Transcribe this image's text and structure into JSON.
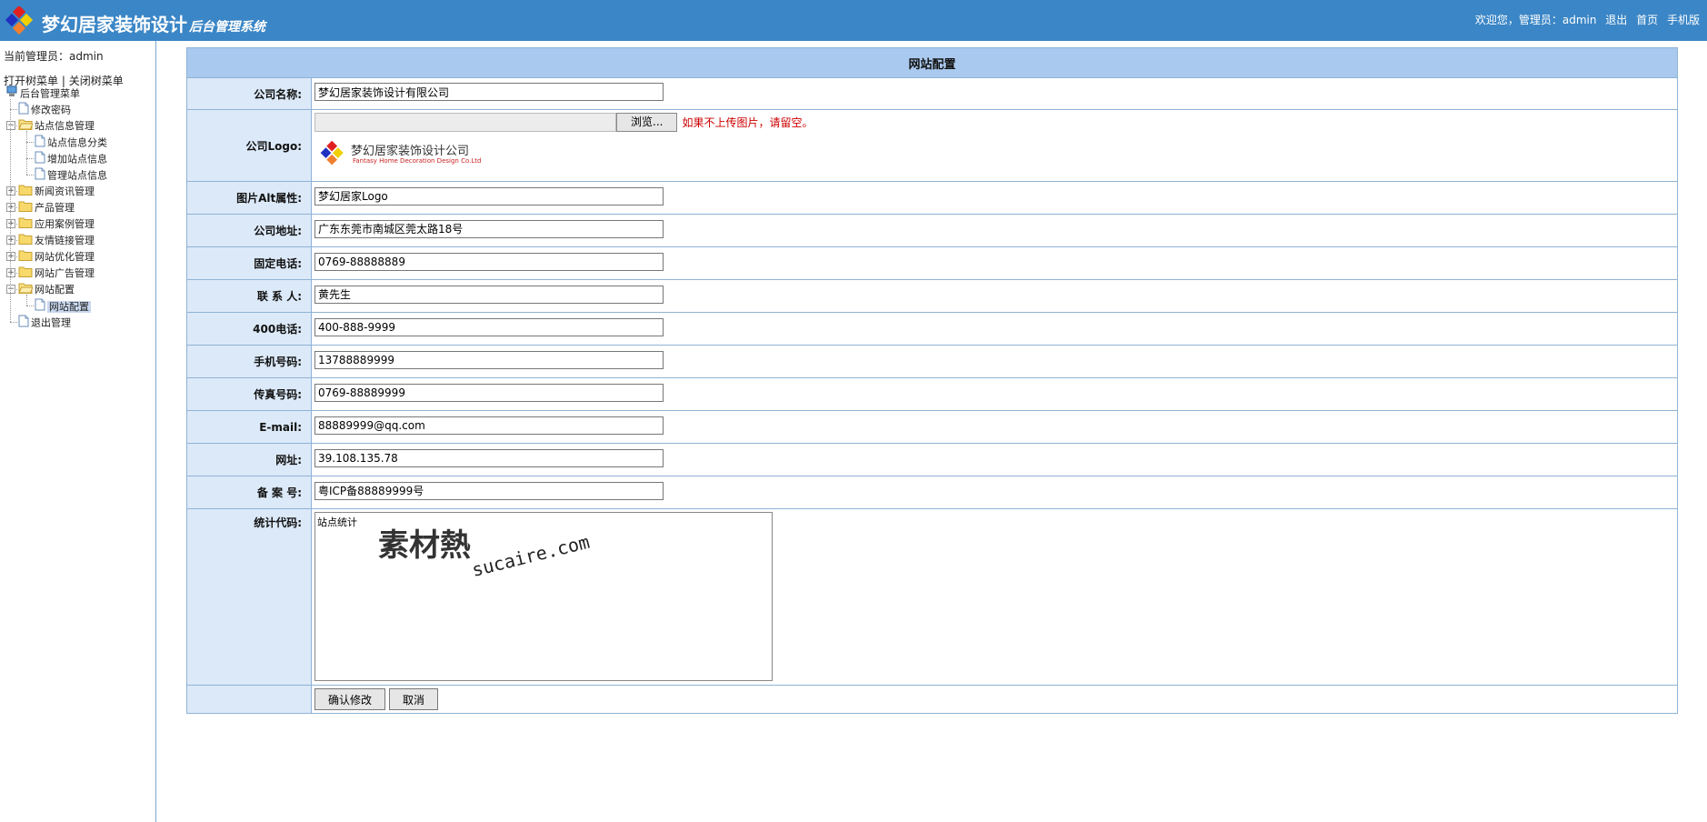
{
  "header": {
    "title": "梦幻居家装饰设计",
    "subtitle": "后台管理系统",
    "welcome": "欢迎您，管理员：admin",
    "links": [
      "退出",
      "首页",
      "手机版"
    ]
  },
  "sidebar": {
    "current_admin": "当前管理员：admin",
    "open_tree": "打开树菜单",
    "separator": "|",
    "close_tree": "关闭树菜单",
    "root": "后台管理菜单",
    "items": [
      {
        "label": "修改密码",
        "type": "page",
        "level": 1
      },
      {
        "label": "站点信息管理",
        "type": "folder-open",
        "level": 1
      },
      {
        "label": "站点信息分类",
        "type": "page",
        "level": 2
      },
      {
        "label": "增加站点信息",
        "type": "page",
        "level": 2
      },
      {
        "label": "管理站点信息",
        "type": "page",
        "level": 2
      },
      {
        "label": "新闻资讯管理",
        "type": "folder",
        "level": 1
      },
      {
        "label": "产品管理",
        "type": "folder",
        "level": 1
      },
      {
        "label": "应用案例管理",
        "type": "folder",
        "level": 1
      },
      {
        "label": "友情链接管理",
        "type": "folder",
        "level": 1
      },
      {
        "label": "网站优化管理",
        "type": "folder",
        "level": 1
      },
      {
        "label": "网站广告管理",
        "type": "folder",
        "level": 1
      },
      {
        "label": "网站配置",
        "type": "folder-open",
        "level": 1
      },
      {
        "label": "网站配置",
        "type": "page",
        "level": 2,
        "selected": true
      },
      {
        "label": "退出管理",
        "type": "page",
        "level": 1
      }
    ]
  },
  "form": {
    "title": "网站配置",
    "company_name_label": "公司名称:",
    "company_name": "梦幻居家装饰设计有限公司",
    "logo_label": "公司Logo:",
    "browse_label": "浏览...",
    "logo_hint": "如果不上传图片，请留空。",
    "logo_text_cn": "梦幻居家装饰设计公司",
    "logo_text_en": "Fantasy Home Decoration Design Co.Ltd",
    "alt_label": "图片Alt属性:",
    "alt_value": "梦幻居家Logo",
    "address_label": "公司地址:",
    "address": "广东东莞市南城区莞太路18号",
    "phone_label": "固定电话:",
    "phone": "0769-88888889",
    "contact_label": "联 系 人:",
    "contact": "黄先生",
    "tel400_label": "400电话:",
    "tel400": "400-888-9999",
    "mobile_label": "手机号码:",
    "mobile": "13788889999",
    "fax_label": "传真号码:",
    "fax": "0769-88889999",
    "email_label": "E-mail:",
    "email": "88889999@qq.com",
    "url_label": "网址:",
    "url": "39.108.135.78",
    "icp_label": "备 案 号:",
    "icp": "粤ICP备88889999号",
    "stats_label": "统计代码:",
    "stats": "站点统计",
    "watermark_cn": "素材熱",
    "watermark_en": "sucaire.com",
    "submit_label": "确认修改",
    "cancel_label": "取消"
  },
  "colors": {
    "header_bg": "#3b86c6",
    "table_head": "#a9c9ee",
    "label_bg": "#dce9f8",
    "hint": "#cc0000"
  }
}
